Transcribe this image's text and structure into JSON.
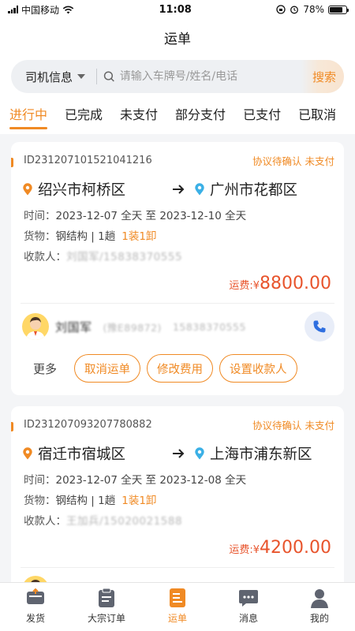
{
  "status_bar": {
    "carrier": "中国移动",
    "time": "11:08",
    "battery": "78%",
    "battery_level": 0.78
  },
  "nav": {
    "title": "运单"
  },
  "search": {
    "category": "司机信息",
    "placeholder": "请输入车牌号/姓名/电话",
    "button": "搜索"
  },
  "tabs": [
    {
      "label": "进行中",
      "active": true
    },
    {
      "label": "已完成"
    },
    {
      "label": "未支付"
    },
    {
      "label": "部分支付"
    },
    {
      "label": "已支付"
    },
    {
      "label": "已取消"
    }
  ],
  "orders": [
    {
      "id": "ID231207101521041216",
      "status": "协议待确认  未支付",
      "from": "绍兴市柯桥区",
      "to": "广州市花都区",
      "time_label": "时间：",
      "time_value": "2023-12-07 全天 至 2023-12-10 全天",
      "goods_label": "货物：",
      "goods_value": "钢结构 | 1趟",
      "goods_tag": "1装1卸",
      "payee_label": "收款人：",
      "payee_value": "刘国军/15838370555",
      "fee_label": "运费:¥",
      "fee_value": "8800.00",
      "driver_name": "刘国军",
      "driver_plate": "(豫E89872)",
      "driver_phone": "15838370555",
      "more": "更多",
      "actions": [
        "取消运单",
        "修改费用",
        "设置收款人"
      ]
    },
    {
      "id": "ID231207093207780882",
      "status": "协议待确认  未支付",
      "from": "宿迁市宿城区",
      "to": "上海市浦东新区",
      "time_label": "时间：",
      "time_value": "2023-12-07 全天 至 2023-12-08 全天",
      "goods_label": "货物：",
      "goods_value": "钢结构 | 1趟",
      "goods_tag": "1装1卸",
      "payee_label": "收款人：",
      "payee_value": "王加兵/15020021588",
      "fee_label": "运费:¥",
      "fee_value": "4200.00"
    }
  ],
  "tabbar": [
    {
      "label": "发货",
      "icon": "truck-icon"
    },
    {
      "label": "大宗订单",
      "icon": "clipboard-icon"
    },
    {
      "label": "运单",
      "icon": "waybill-icon",
      "active": true
    },
    {
      "label": "消息",
      "icon": "message-icon"
    },
    {
      "label": "我的",
      "icon": "person-icon"
    }
  ],
  "colors": {
    "accent": "#f08a24",
    "fee": "#e8542c",
    "pin": "#f08a24",
    "pin_dest": "#3bb0e6"
  }
}
